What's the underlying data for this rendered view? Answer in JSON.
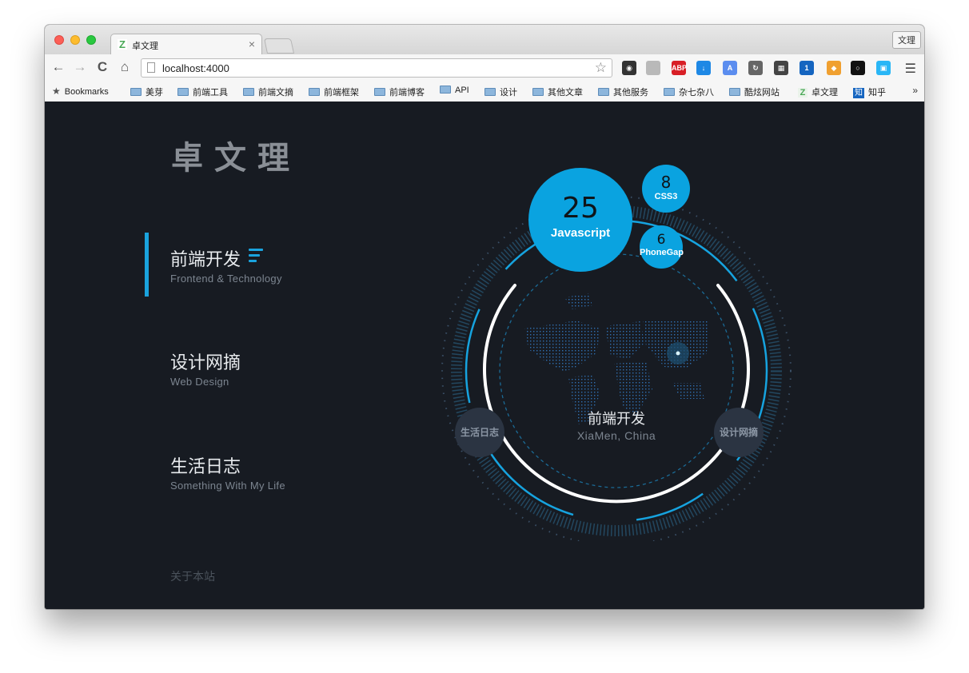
{
  "browser": {
    "tab": {
      "favicon": "Z",
      "title": "卓文理",
      "close": "×"
    },
    "profile_button": "文理",
    "omnibox": {
      "url": "localhost:4000"
    },
    "nav": {
      "back": "←",
      "forward": "→",
      "reload": "C",
      "home": "⌂"
    },
    "extensions": [
      {
        "name": "color-picker-icon",
        "color": "#333333",
        "glyph": "◉"
      },
      {
        "name": "ghost-icon",
        "color": "#b9b9b9",
        "glyph": ""
      },
      {
        "name": "adblock-icon",
        "color": "#d81f26",
        "glyph": "ABP"
      },
      {
        "name": "download-icon",
        "color": "#1e88e5",
        "glyph": "↓"
      },
      {
        "name": "translate-icon",
        "color": "#5b8def",
        "glyph": "A"
      },
      {
        "name": "sync-icon",
        "color": "#666666",
        "glyph": "↻"
      },
      {
        "name": "qr-code-icon",
        "color": "#444444",
        "glyph": "▦"
      },
      {
        "name": "notifier-icon",
        "color": "#1565c0",
        "glyph": "1"
      },
      {
        "name": "zenmate-icon",
        "color": "#f0a030",
        "glyph": "◆"
      },
      {
        "name": "circle-icon",
        "color": "#111111",
        "glyph": "○"
      },
      {
        "name": "screenshot-icon",
        "color": "#29b6f6",
        "glyph": "▣"
      }
    ],
    "bookmarks_label": "Bookmarks",
    "bookmarks": [
      "美芽",
      "前端工具",
      "前端文摘",
      "前端框架",
      "前端博客",
      "API",
      "设计",
      "其他文章",
      "其他服务",
      "杂七杂八",
      "酷炫网站"
    ],
    "bookmark_site_1": {
      "favicon": "Z",
      "label": "卓文理"
    },
    "bookmark_site_2": {
      "favicon": "知",
      "label": "知乎"
    },
    "bookmarks_more": "»"
  },
  "site": {
    "title": "卓文理",
    "nav": [
      {
        "zh": "前端开发",
        "en": "Frontend & Technology",
        "active": true
      },
      {
        "zh": "设计网摘",
        "en": "Web Design",
        "active": false
      },
      {
        "zh": "生活日志",
        "en": "Something With My Life",
        "active": false
      }
    ],
    "about": "关于本站"
  },
  "visualization": {
    "bubbles": [
      {
        "count": "25",
        "label": "Javascript"
      },
      {
        "count": "8",
        "label": "CSS3"
      },
      {
        "count": "6",
        "label": "PhoneGap"
      }
    ],
    "left_node": "生活日志",
    "right_node": "设计网摘",
    "center_title": "前端开发",
    "center_location": "XiaMen, China"
  },
  "colors": {
    "accent": "#0aa3e0",
    "background": "#171b22",
    "node": "#2b3442"
  }
}
